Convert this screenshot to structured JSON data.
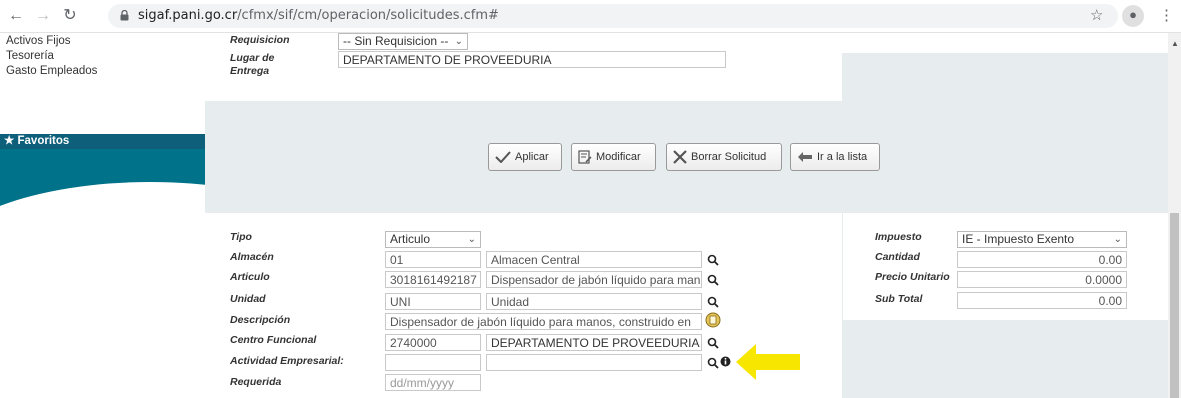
{
  "browser": {
    "url_domain": "sigaf.pani.go.cr",
    "url_path": "/cfmx/sif/cm/operacion/solicitudes.cfm#"
  },
  "sidebar": {
    "links": [
      "Activos Fijos",
      "Tesorería",
      "Gasto Empleados"
    ],
    "favorites_label": "Favoritos"
  },
  "top_form": {
    "requisicion_label": "Requisicion",
    "requisicion_value": "-- Sin Requisicion --",
    "lugar_label_1": "Lugar de",
    "lugar_label_2": "Entrega",
    "lugar_value": "DEPARTAMENTO DE PROVEEDURIA"
  },
  "actions": {
    "aplicar": "Aplicar",
    "modificar": "Modificar",
    "borrar": "Borrar Solicitud",
    "ir_lista": "Ir a la lista"
  },
  "detail_form": {
    "tipo_label": "Tipo",
    "tipo_value": "Articulo",
    "almacen_label": "Almacén",
    "almacen_code": "01",
    "almacen_name": "Almacen Central",
    "articulo_label": "Articulo",
    "articulo_code": "3018161492187",
    "articulo_name": "Dispensador de jabón líquido para mano",
    "unidad_label": "Unidad",
    "unidad_code": "UNI",
    "unidad_name": "Unidad",
    "descripcion_label": "Descripción",
    "descripcion_value": "Dispensador de jabón líquido para manos, construido en",
    "centro_label": "Centro Funcional",
    "centro_code": "2740000",
    "centro_name": "DEPARTAMENTO DE PROVEEDURIA",
    "actividad_label": "Actividad Empresarial:",
    "actividad_code": "",
    "actividad_name": "",
    "requerida_label": "Requerida",
    "requerida_placeholder": "dd/mm/yyyy"
  },
  "totals": {
    "impuesto_label": "Impuesto",
    "impuesto_value": "IE - Impuesto Exento",
    "cantidad_label": "Cantidad",
    "cantidad_value": "0.00",
    "precio_label": "Precio Unitario",
    "precio_value": "0.0000",
    "subtotal_label": "Sub Total",
    "subtotal_value": "0.00"
  },
  "colors": {
    "sidebar_teal": "#00728a",
    "main_bg": "#e7ecee",
    "highlight_arrow": "#f7e600"
  }
}
